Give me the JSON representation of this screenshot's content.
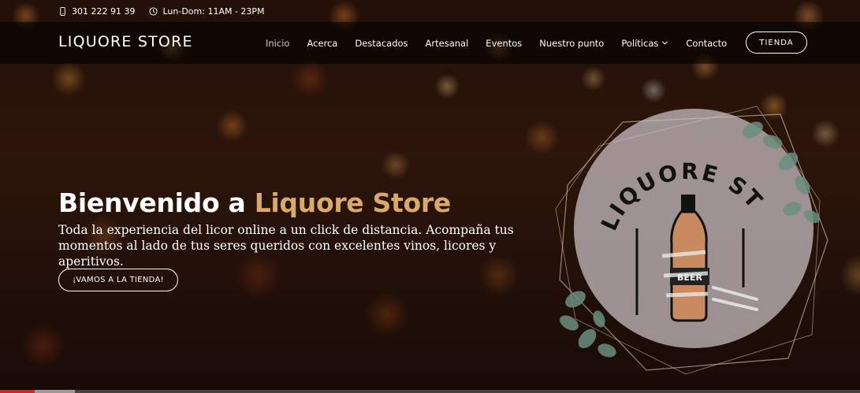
{
  "topbar": {
    "phone": "301 222 91 39",
    "hours": "Lun-Dom: 11AM - 23PM"
  },
  "header": {
    "logo": "LIQUORE STORE",
    "nav": [
      {
        "label": "Inicio",
        "active": true
      },
      {
        "label": "Acerca"
      },
      {
        "label": "Destacados"
      },
      {
        "label": "Artesanal"
      },
      {
        "label": "Eventos"
      },
      {
        "label": "Nuestro punto"
      },
      {
        "label": "Políticas",
        "dropdown": true
      },
      {
        "label": "Contacto"
      }
    ],
    "cta": "TIENDA"
  },
  "hero": {
    "title_part1": "Bienvenido a ",
    "title_accent": "Liquore Store",
    "subtitle": "Toda la experiencia del licor online a un click de distancia. Acompaña tus momentos al lado de tus seres queridos con excelentes vinos, licores y aperitivos.",
    "button": "¡VAMOS A LA TIENDA!"
  },
  "emblem": {
    "arc_text": "LIQUORE STORE",
    "label": "BEER"
  },
  "colors": {
    "accent": "#d9a96c",
    "progress": "#e01e1e"
  },
  "progress": {
    "played_fraction": 0.04,
    "buffered_fraction": 0.087
  }
}
